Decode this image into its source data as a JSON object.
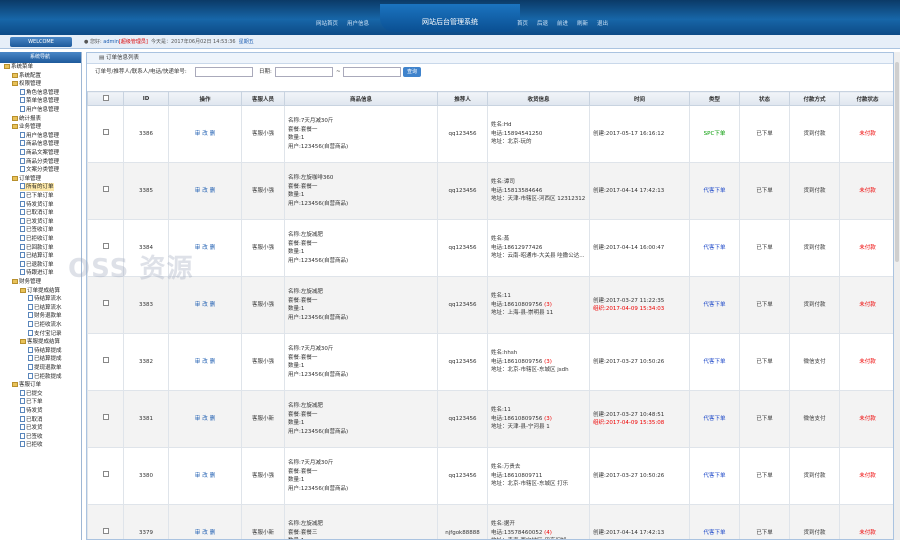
{
  "header": {
    "title": "网站后台管理系统",
    "left_links": [
      "网站首页",
      "用户信息"
    ],
    "right_links": [
      "首页",
      "后退",
      "前进",
      "刷新",
      "退出"
    ]
  },
  "welcome": {
    "label": "WELCOME",
    "user_prefix": "您好:",
    "user": "admin",
    "role": "[超级管理员]",
    "date_text": "今天是：2017年06月02日 14:53:36",
    "weekday": "星期五"
  },
  "sidebar": {
    "title": "系统导航",
    "items": [
      {
        "t": "系统菜单",
        "d": 0,
        "k": "fold"
      },
      {
        "t": "系统配置",
        "d": 1,
        "k": "fold"
      },
      {
        "t": "权限管理",
        "d": 1,
        "k": "fold"
      },
      {
        "t": "角色信息管理",
        "d": 2,
        "k": "page"
      },
      {
        "t": "菜单信息管理",
        "d": 2,
        "k": "page"
      },
      {
        "t": "用户信息管理",
        "d": 2,
        "k": "page"
      },
      {
        "t": "统计报表",
        "d": 1,
        "k": "fold"
      },
      {
        "t": "业务管理",
        "d": 1,
        "k": "fold"
      },
      {
        "t": "用户信息管理",
        "d": 2,
        "k": "page"
      },
      {
        "t": "商品信息管理",
        "d": 2,
        "k": "page"
      },
      {
        "t": "商品文案管理",
        "d": 2,
        "k": "page"
      },
      {
        "t": "商品分类管理",
        "d": 2,
        "k": "page"
      },
      {
        "t": "文案分类管理",
        "d": 2,
        "k": "page"
      },
      {
        "t": "订单管理",
        "d": 1,
        "k": "fold"
      },
      {
        "t": "所有的订单",
        "d": 2,
        "k": "page",
        "sel": true
      },
      {
        "t": "已下单订单",
        "d": 2,
        "k": "page"
      },
      {
        "t": "待发货订单",
        "d": 2,
        "k": "page"
      },
      {
        "t": "已取消订单",
        "d": 2,
        "k": "page"
      },
      {
        "t": "已发货订单",
        "d": 2,
        "k": "page"
      },
      {
        "t": "已签收订单",
        "d": 2,
        "k": "page"
      },
      {
        "t": "已拒收订单",
        "d": 2,
        "k": "page"
      },
      {
        "t": "已回款订单",
        "d": 2,
        "k": "page"
      },
      {
        "t": "已结算订单",
        "d": 2,
        "k": "page"
      },
      {
        "t": "已退款订单",
        "d": 2,
        "k": "page"
      },
      {
        "t": "待跟进订单",
        "d": 2,
        "k": "page"
      },
      {
        "t": "财务管理",
        "d": 1,
        "k": "fold"
      },
      {
        "t": "订单提成结算",
        "d": 2,
        "k": "fold"
      },
      {
        "t": "待结算流水",
        "d": 3,
        "k": "page"
      },
      {
        "t": "已结算流水",
        "d": 3,
        "k": "page"
      },
      {
        "t": "财务退款单",
        "d": 3,
        "k": "page"
      },
      {
        "t": "已拒收流水",
        "d": 3,
        "k": "page"
      },
      {
        "t": "支付宝记录",
        "d": 3,
        "k": "page"
      },
      {
        "t": "客服提成结算",
        "d": 2,
        "k": "fold"
      },
      {
        "t": "待结算提成",
        "d": 3,
        "k": "page"
      },
      {
        "t": "已结算提成",
        "d": 3,
        "k": "page"
      },
      {
        "t": "提现退款单",
        "d": 3,
        "k": "page"
      },
      {
        "t": "已拒款提成",
        "d": 3,
        "k": "page"
      },
      {
        "t": "客服订单",
        "d": 1,
        "k": "fold"
      },
      {
        "t": "已提交",
        "d": 2,
        "k": "page"
      },
      {
        "t": "已下单",
        "d": 2,
        "k": "page"
      },
      {
        "t": "待发货",
        "d": 2,
        "k": "page"
      },
      {
        "t": "已取消",
        "d": 2,
        "k": "page"
      },
      {
        "t": "已发货",
        "d": 2,
        "k": "page"
      },
      {
        "t": "已签收",
        "d": 2,
        "k": "page"
      },
      {
        "t": "已拒收",
        "d": 2,
        "k": "page"
      }
    ]
  },
  "main": {
    "breadcrumb": "订单信息列表",
    "search": {
      "label": "订单号/推荐人/联系人/电话/快递单号:",
      "date_label": "日期:",
      "range_sep": "~",
      "button": "查询"
    },
    "columns": [
      "",
      "ID",
      "操作",
      "客服人员",
      "商品信息",
      "推荐人",
      "收货信息",
      "时间",
      "类型",
      "状态",
      "付款方式",
      "付款状态"
    ],
    "ops": [
      "审",
      "改",
      "删"
    ],
    "rows": [
      {
        "id": "3386",
        "staff": "客服小强",
        "goods": [
          "名称:7天月减30斤",
          "套餐:套餐一",
          "数量:1",
          "用户:123456(自营商品)"
        ],
        "ref": "qq123456",
        "recv": [
          "姓名:Hd",
          "电话:15894541250",
          "地址：北京-玩的"
        ],
        "time": [
          "创建:2017-05-17 16:16:12"
        ],
        "type": "SPC下单",
        "tcls": "green",
        "status": "已下单",
        "pay": "货到付款",
        "pstat": "未付款"
      },
      {
        "id": "3385",
        "staff": "客服小强",
        "goods": [
          "名称:左旋咖啡360",
          "套餐:套餐一",
          "数量:1",
          "用户:123456(自营商品)"
        ],
        "ref": "qq123456",
        "recv": [
          "姓名:谭司",
          "电话:15813584646",
          "地址：天津-市辖区-河西区 12312312"
        ],
        "time": [
          "创建:2017-04-14 17:42:13"
        ],
        "type": "代客下单",
        "tcls": "blue2",
        "status": "已下单",
        "pay": "货到付款",
        "pstat": "未付款"
      },
      {
        "id": "3384",
        "staff": "客服小强",
        "goods": [
          "名称:左旋减肥",
          "套餐:套餐一",
          "数量:1",
          "用户:123456(自营商品)"
        ],
        "ref": "qq123456",
        "recv": [
          "姓名:蒸",
          "电话:18612977426",
          "地址：云南-昭通市-大关县 哇撒公达..."
        ],
        "time": [
          "创建:2017-04-14 16:00:47"
        ],
        "type": "代客下单",
        "tcls": "blue2",
        "status": "已下单",
        "pay": "货到付款",
        "pstat": "未付款"
      },
      {
        "id": "3383",
        "staff": "客服小强",
        "goods": [
          "名称:左旋减肥",
          "套餐:套餐一",
          "数量:1",
          "用户:123456(自营商品)"
        ],
        "ref": "qq123456",
        "recv": [
          "姓名:11",
          "电话:18610809756 (3)",
          "地址：上海-县-崇明县 11"
        ],
        "time": [
          "创建:2017-03-27 11:22:35",
          "组织:2017-04-09 15:34:03"
        ],
        "type": "代客下单",
        "tcls": "blue2",
        "status": "已下单",
        "pay": "货到付款",
        "pstat": "未付款"
      },
      {
        "id": "3382",
        "staff": "客服小强",
        "goods": [
          "名称:7天月减30斤",
          "套餐:套餐一",
          "数量:1",
          "用户:123456(自营商品)"
        ],
        "ref": "qq123456",
        "recv": [
          "姓名:hhsh",
          "电话:18610809756 (3)",
          "地址：北京-市辖区-东城区 jsdh"
        ],
        "time": [
          "创建:2017-03-27 10:50:26"
        ],
        "type": "代客下单",
        "tcls": "blue2",
        "status": "已下单",
        "pay": "微信支付",
        "pstat": "未付款"
      },
      {
        "id": "3381",
        "staff": "客服小新",
        "goods": [
          "名称:左旋减肥",
          "套餐:套餐一",
          "数量:1",
          "用户:123456(自营商品)"
        ],
        "ref": "qq123456",
        "recv": [
          "姓名:11",
          "电话:18610809756 (3)",
          "地址：天津-县-宁河县 1"
        ],
        "time": [
          "创建:2017-03-27 10:48:51",
          "组织:2017-04-09 15:35:08"
        ],
        "type": "代客下单",
        "tcls": "blue2",
        "status": "已下单",
        "pay": "微信支付",
        "pstat": "未付款"
      },
      {
        "id": "3380",
        "staff": "客服小强",
        "goods": [
          "名称:7天月减30斤",
          "套餐:套餐一",
          "数量:1",
          "用户:123456(自营商品)"
        ],
        "ref": "qq123456",
        "recv": [
          "姓名:万贵去",
          "电话:18610809711",
          "地址：北京-市辖区-东城区 打乐"
        ],
        "time": [
          "创建:2017-03-27 10:50:26"
        ],
        "type": "代客下单",
        "tcls": "blue2",
        "status": "已下单",
        "pay": "货到付款",
        "pstat": "未付款"
      },
      {
        "id": "3379",
        "staff": "客服小新",
        "goods": [
          "名称:左旋减肥",
          "套餐:套餐三",
          "数量:1"
        ],
        "ref": "njfgok88888",
        "recv": [
          "姓名:据开",
          "电话:13578460052 (4)",
          "地址：青海-西宁地区-甲亥旧知..."
        ],
        "time": [
          "创建:2017-04-14 17:42:13"
        ],
        "type": "代客下单",
        "tcls": "blue2",
        "status": "已下单",
        "pay": "货到付款",
        "pstat": "未付款"
      }
    ]
  },
  "watermark": "OSS 资源"
}
